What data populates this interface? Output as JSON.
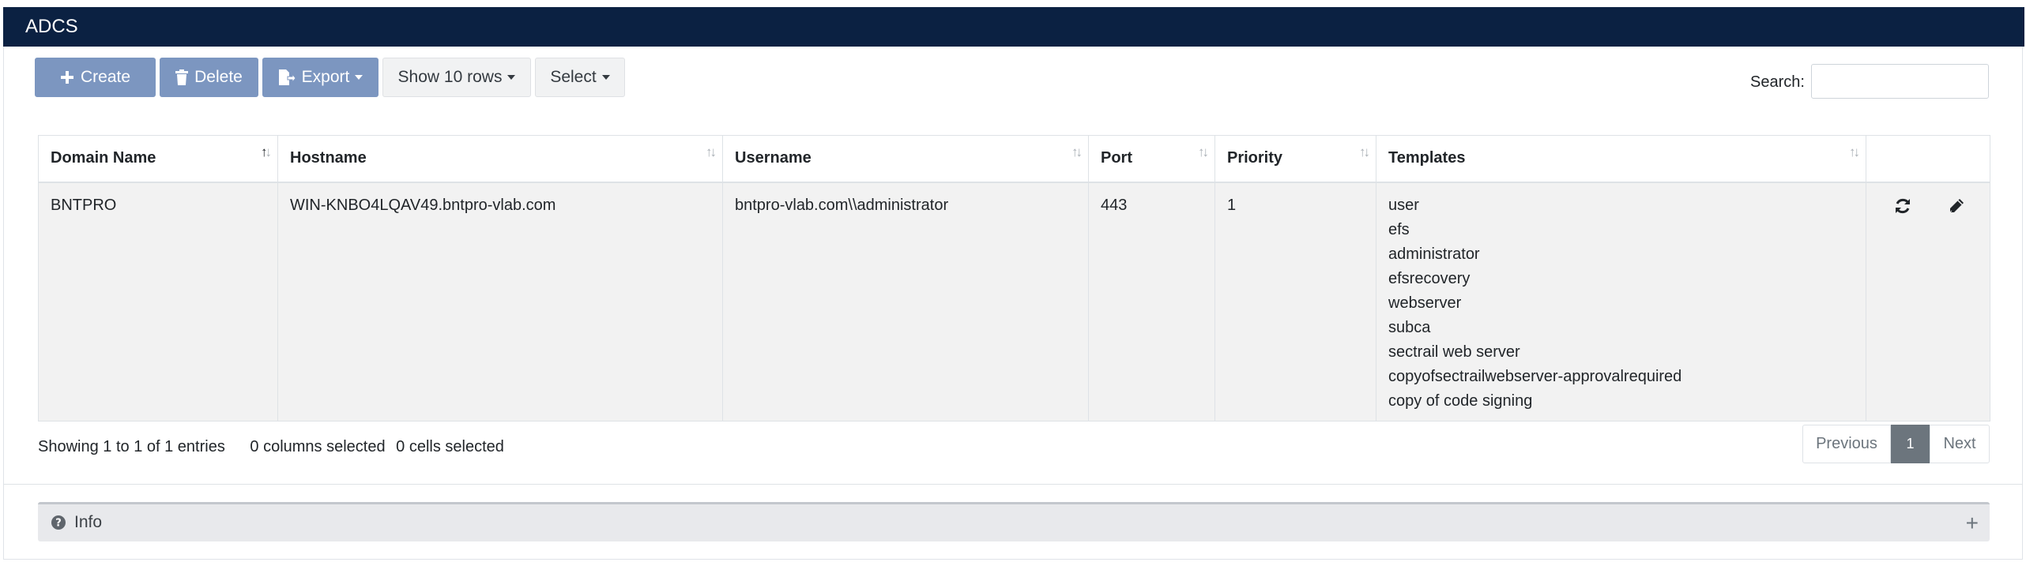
{
  "panel": {
    "title": "ADCS"
  },
  "toolbar": {
    "create_label": "Create",
    "delete_label": "Delete",
    "export_label": "Export",
    "show_rows_label": "Show 10 rows",
    "select_label": "Select",
    "colors": {
      "primary": "#7c96c0",
      "header": "#0b2142"
    }
  },
  "search": {
    "label": "Search:",
    "value": "",
    "placeholder": ""
  },
  "table": {
    "columns": [
      "Domain Name",
      "Hostname",
      "Username",
      "Port",
      "Priority",
      "Templates"
    ],
    "rows": [
      {
        "domain_name": "BNTPRO",
        "hostname": "WIN-KNBO4LQAV49.bntpro-vlab.com",
        "username": "bntpro-vlab.com\\\\administrator",
        "port": "443",
        "priority": "1",
        "templates": [
          "user",
          "efs",
          "administrator",
          "efsrecovery",
          "webserver",
          "subca",
          "sectrail web server",
          "copyofsectrailwebserver-approvalrequired",
          "copy of code signing"
        ]
      }
    ]
  },
  "footer": {
    "showing": "Showing 1 to 1 of 1 entries",
    "columns_selected": "0 columns selected",
    "cells_selected": "0 cells selected"
  },
  "pagination": {
    "previous": "Previous",
    "current": "1",
    "next": "Next"
  },
  "info": {
    "title": "Info",
    "expand_icon": "+"
  }
}
